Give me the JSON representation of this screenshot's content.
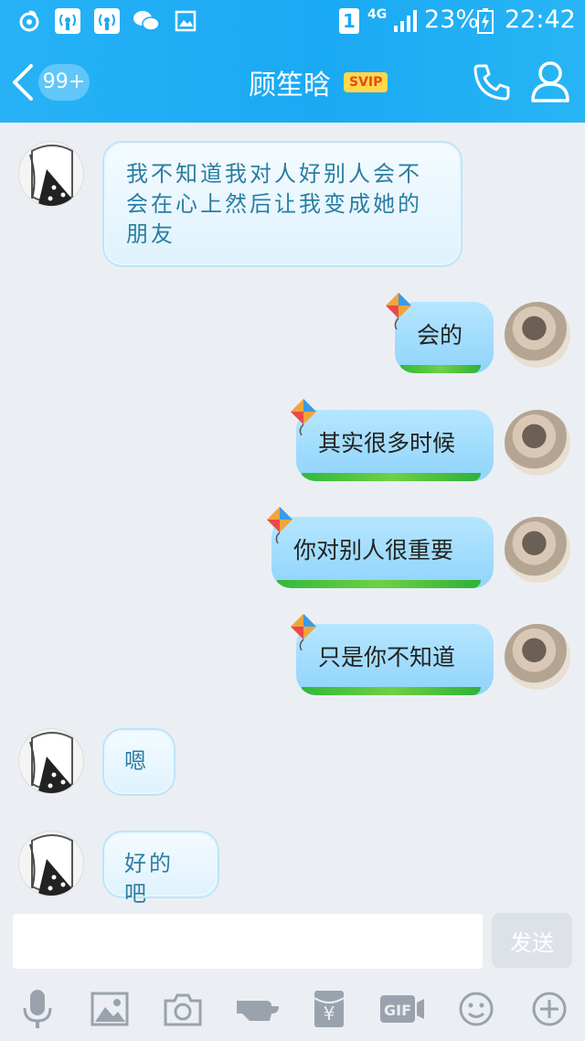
{
  "status_bar": {
    "sim": "1",
    "network": "4G",
    "battery": "23%",
    "time": "22:42"
  },
  "nav": {
    "unread_badge": "99+",
    "title": "顾笙晗",
    "vip_badge": "SVIP"
  },
  "messages": [
    {
      "side": "left",
      "text": "我不知道我对人好别人会不会在心上然后让我变成她的朋友"
    },
    {
      "side": "right",
      "text": "会的"
    },
    {
      "side": "right",
      "text": "其实很多时候"
    },
    {
      "side": "right",
      "text": "你对别人很重要"
    },
    {
      "side": "right",
      "text": "只是你不知道"
    },
    {
      "side": "left",
      "text": "嗯"
    },
    {
      "side": "left",
      "text": "好的吧"
    }
  ],
  "composer": {
    "input_value": "",
    "send_label": "发送"
  },
  "toolbar": {
    "gif_label": "GIF",
    "money_label": "¥"
  },
  "colors": {
    "header": "#1aa9f3",
    "background": "#ebeff4",
    "left_bubble_text": "#2a7ea2",
    "right_bubble": "#9ddbfd",
    "svip": "#ffd84a"
  }
}
